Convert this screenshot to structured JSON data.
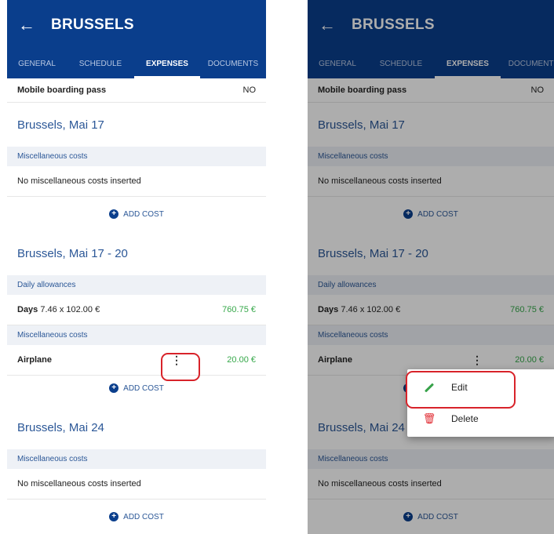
{
  "header": {
    "back_icon": "arrow-left-icon",
    "title": "BRUSSELS"
  },
  "tabs": [
    "GENERAL",
    "SCHEDULE",
    "EXPENSES",
    "DOCUMENTS"
  ],
  "active_tab": "EXPENSES",
  "boarding": {
    "label": "Mobile boarding pass",
    "value": "NO"
  },
  "sections": [
    {
      "title": "Brussels, Mai 17",
      "misc_header": "Miscellaneous costs",
      "misc_empty": "No miscellaneous costs inserted",
      "add_cost": "ADD COST"
    },
    {
      "title": "Brussels, Mai 17 - 20",
      "daily_header": "Daily allowances",
      "days_label": "Days",
      "days_formula": "7.46 x 102.00 €",
      "days_amount": "760.75 €",
      "misc_header": "Miscellaneous costs",
      "item_label": "Airplane",
      "item_amount": "20.00 €",
      "add_cost": "ADD COST"
    },
    {
      "title": "Brussels, Mai 24",
      "misc_header": "Miscellaneous costs",
      "misc_empty": "No miscellaneous costs inserted",
      "add_cost": "ADD COST"
    }
  ],
  "context_menu": {
    "edit_label": "Edit",
    "delete_label": "Delete",
    "edit_icon": "pencil-icon",
    "delete_icon": "trash-icon"
  },
  "colors": {
    "brand": "#0a3e8c",
    "accent_text": "#2b5797",
    "amount_green": "#36a84a",
    "highlight_red": "#d8232a",
    "delete_red": "#e0282f"
  }
}
